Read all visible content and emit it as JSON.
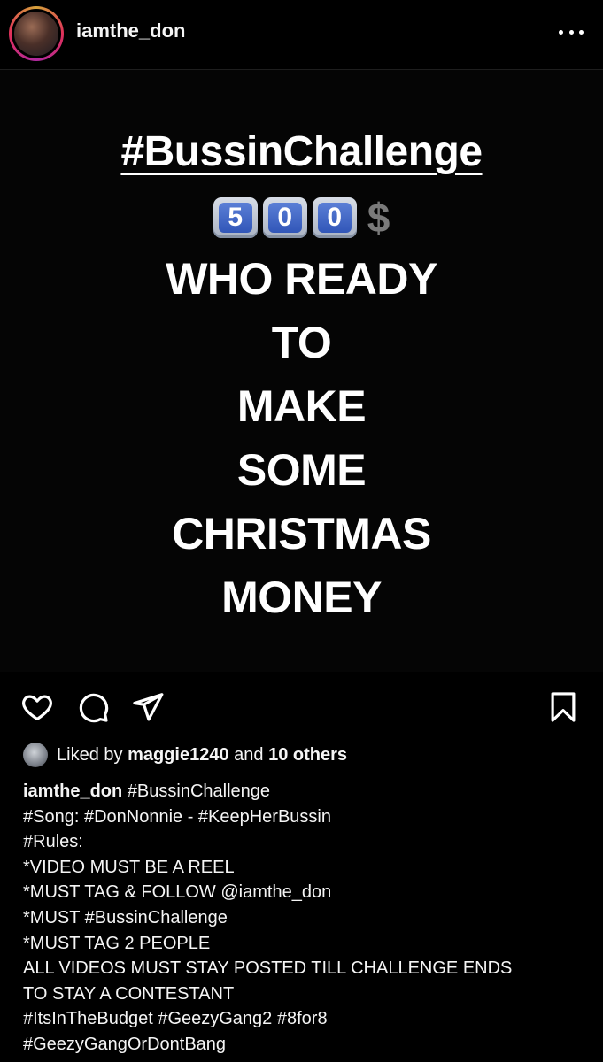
{
  "header": {
    "username": "iamthe_don",
    "avatar_icon": "profile-avatar",
    "more_icon": "more-dots-icon"
  },
  "post_image": {
    "title": "#BussinChallenge",
    "keycaps": [
      "5",
      "0",
      "0"
    ],
    "currency": "$",
    "lines": [
      "WHO READY",
      "TO",
      "MAKE",
      "SOME",
      "CHRISTMAS",
      "MONEY"
    ]
  },
  "actions": {
    "like_icon": "heart-icon",
    "comment_icon": "comment-icon",
    "share_icon": "send-icon",
    "save_icon": "bookmark-icon"
  },
  "likes": {
    "prefix": "Liked by",
    "user": "maggie1240",
    "connector": "and",
    "others": "10 others"
  },
  "caption": {
    "username": "iamthe_don",
    "first": "#BussinChallenge",
    "lines": [
      "#Song: #DonNonnie - #KeepHerBussin",
      "#Rules:",
      "*VIDEO MUST BE A REEL",
      "*MUST TAG & FOLLOW @iamthe_don",
      "*MUST #BussinChallenge",
      "*MUST TAG 2 PEOPLE",
      "ALL VIDEOS MUST STAY POSTED TILL CHALLENGE ENDS",
      "TO STAY A CONTESTANT",
      "#ItsInTheBudget #GeezyGang2 #8for8",
      "#GeezyGangOrDontBang"
    ]
  }
}
